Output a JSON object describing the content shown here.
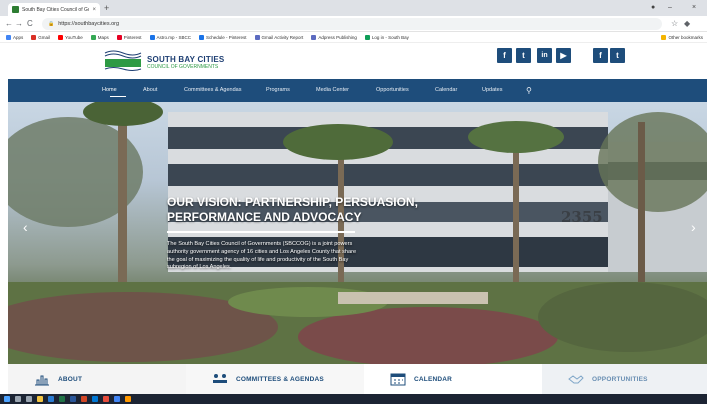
{
  "browser": {
    "tab_title": "South Bay Cities Council of Gov",
    "tab_close": "×",
    "new_tab": "+",
    "url": "https://southbaycities.org",
    "back": "←",
    "forward": "→",
    "reload": "C",
    "star": "☆",
    "bookmarks": [
      {
        "label": "Apps",
        "color": "#4285f4"
      },
      {
        "label": "Gmail",
        "color": "#d93025"
      },
      {
        "label": "YouTube",
        "color": "#ff0000"
      },
      {
        "label": "Maps",
        "color": "#34a853"
      },
      {
        "label": "Pinterest",
        "color": "#e60023"
      },
      {
        "label": "Astro.mp - SBCC",
        "color": "#1a73e8"
      },
      {
        "label": "Schedule - Pinterest",
        "color": "#1a73e8"
      },
      {
        "label": "Gmail Activity Report",
        "color": "#5c6bc0"
      },
      {
        "label": "Adpress Publishing",
        "color": "#5c6bc0"
      },
      {
        "label": "Log in - South Bay",
        "color": "#0f9d58"
      }
    ],
    "other_bookmarks": "Other bookmarks"
  },
  "header": {
    "logo_name": "SOUTH BAY CITIES",
    "logo_sub": "COUNCIL OF GOVERNMENTS",
    "social": [
      {
        "icon": "facebook-icon",
        "glyph": "f"
      },
      {
        "icon": "twitter-icon",
        "glyph": "t"
      },
      {
        "icon": "linkedin-icon",
        "glyph": "in"
      },
      {
        "icon": "youtube-icon",
        "glyph": "▶"
      },
      {
        "icon": "facebook-icon",
        "glyph": "f"
      },
      {
        "icon": "twitter-icon",
        "glyph": "t"
      }
    ]
  },
  "nav": {
    "items": [
      "Home",
      "About",
      "Committees & Agendas",
      "Programs",
      "Media Center",
      "Opportunities",
      "Calendar",
      "Updates"
    ],
    "active": "Home",
    "search_glyph": "⚲"
  },
  "hero": {
    "title": "OUR VISION: PARTNERSHIP, PERSUASION, PERFORMANCE AND ADVOCACY",
    "body": "The South Bay Cities Council of Governments (SBCCOG) is a joint powers authority government agency of 16 cities and Los Angeles County that share the goal of maximizing the quality of life and productivity of the South Bay subregion of Los Angeles.",
    "building_number": "2355",
    "prev_arrow": "‹",
    "next_arrow": "›"
  },
  "tiles": [
    {
      "label": "ABOUT",
      "icon": "city-icon"
    },
    {
      "label": "COMMITTEES & AGENDAS",
      "icon": "meeting-icon"
    },
    {
      "label": "CALENDAR",
      "icon": "calendar-icon"
    },
    {
      "label": "OPPORTUNITIES",
      "icon": "handshake-icon"
    }
  ],
  "colors": {
    "brand_blue": "#1e4d7b",
    "brand_green": "#2e9a44",
    "logo_navy": "#1e3f73"
  }
}
